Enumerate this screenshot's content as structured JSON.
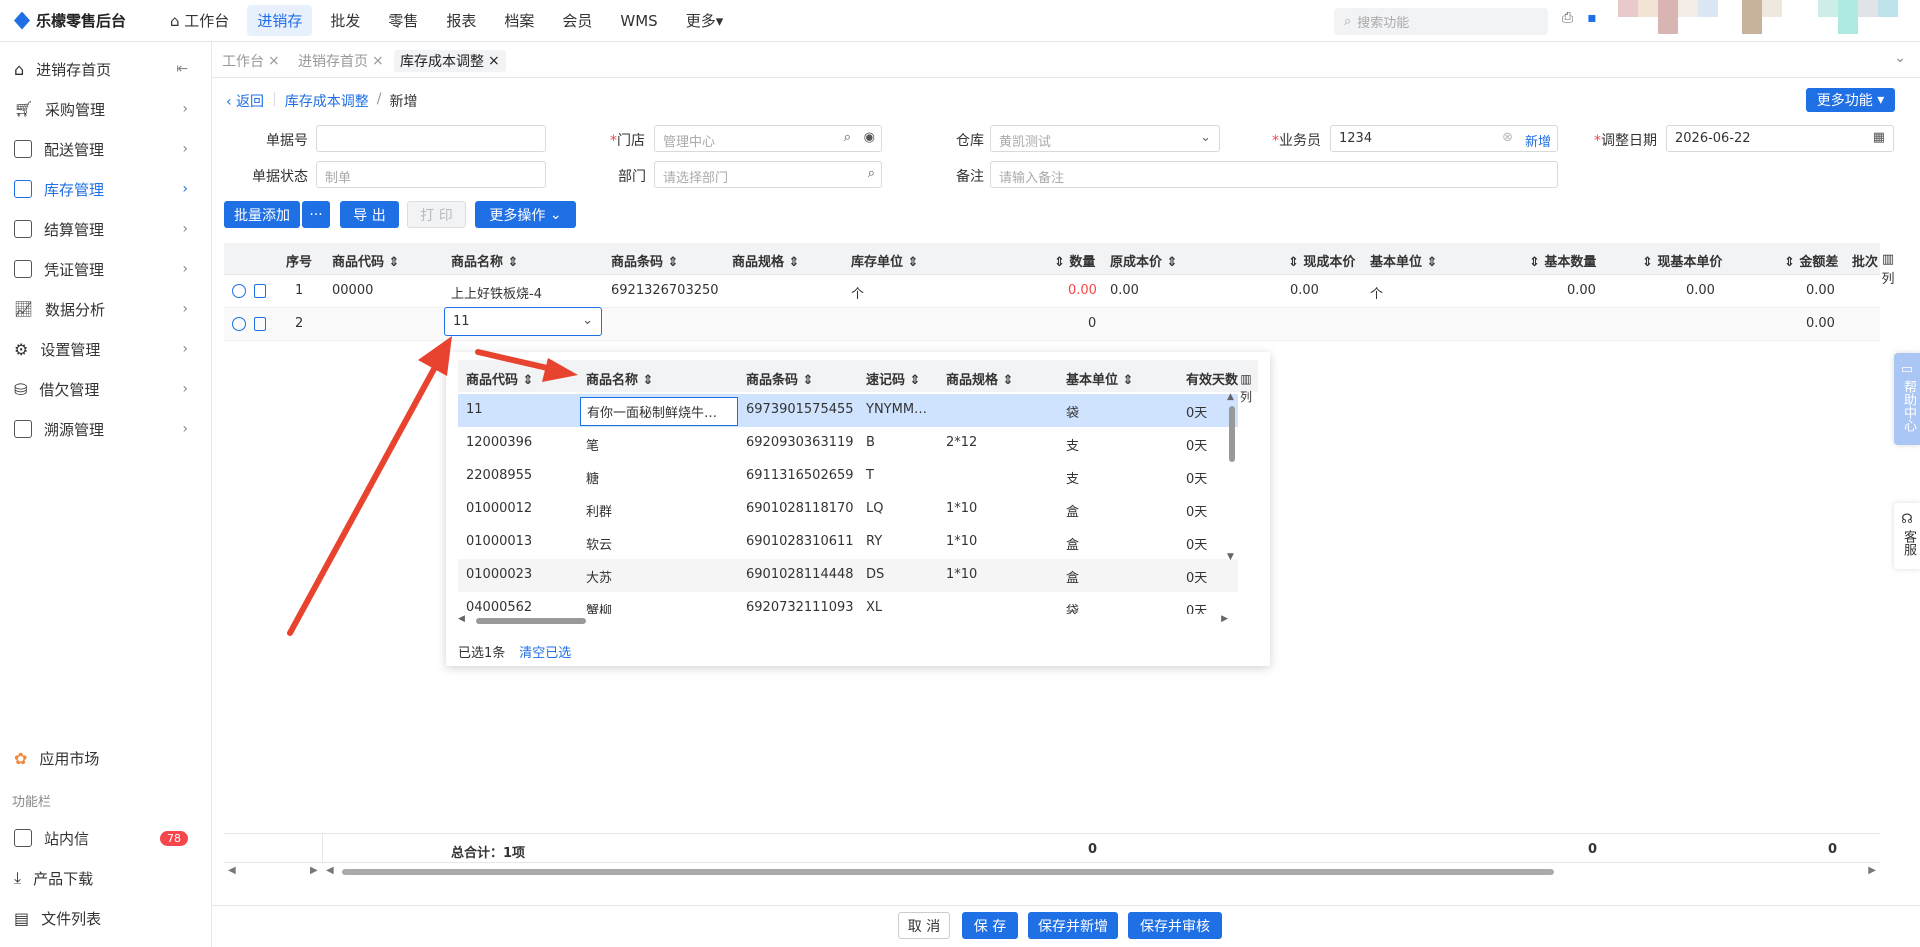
{
  "app": {
    "title": "乐檬零售后台"
  },
  "topnav": [
    "工作台",
    "进销存",
    "批发",
    "零售",
    "报表",
    "档案",
    "会员",
    "WMS",
    "更多"
  ],
  "search": {
    "placeholder": "搜索功能"
  },
  "sidebar": {
    "items": [
      "进销存首页",
      "采购管理",
      "配送管理",
      "库存管理",
      "结算管理",
      "凭证管理",
      "数据分析",
      "设置管理",
      "借欠管理",
      "溯源管理"
    ],
    "app_market": "应用市场",
    "section": "功能栏",
    "inbox": "站内信",
    "inbox_badge": "78",
    "download": "产品下载",
    "files": "文件列表"
  },
  "tabs": [
    "工作台",
    "进销存首页",
    "库存成本调整"
  ],
  "breadcrumb": {
    "back": "返回",
    "parent": "库存成本调整",
    "current": "新增"
  },
  "more_func": "更多功能",
  "form": {
    "doc_no_label": "单据号",
    "doc_no_value": "",
    "store_label": "门店",
    "store_placeholder": "管理中心",
    "warehouse_label": "仓库",
    "warehouse_placeholder": "黄凯测试",
    "salesman_label": "业务员",
    "salesman_value": "1234",
    "salesman_add": "新增",
    "date_label": "调整日期",
    "date_value": "2026-06-22",
    "status_label": "单据状态",
    "status_placeholder": "制单",
    "dept_label": "部门",
    "dept_placeholder": "请选择部门",
    "remark_label": "备注",
    "remark_placeholder": "请输入备注"
  },
  "toolbar": {
    "batch_add": "批量添加",
    "more_dots": "···",
    "export": "导 出",
    "print": "打 印",
    "more_ops": "更多操作"
  },
  "table": {
    "headers": [
      "序号",
      "商品代码",
      "商品名称",
      "商品条码",
      "商品规格",
      "库存单位",
      "数量",
      "原成本价",
      "现成本价",
      "基本单位",
      "基本数量",
      "现基本单价",
      "金额差",
      "批次"
    ],
    "col_setting": "列",
    "rows": [
      {
        "idx": "1",
        "code": "00000",
        "name": "上上好铁板烧-4",
        "barcode": "6921326703250",
        "unit": "个",
        "qty": "0.00",
        "old_cost": "0.00",
        "new_cost": "0.00",
        "base_unit": "个",
        "base_qty": "0.00",
        "base_price": "0.00",
        "diff": "0.00"
      },
      {
        "idx": "2",
        "select_value": "11",
        "qty": "0",
        "diff": "0.00"
      }
    ],
    "total_label": "总合计：1项",
    "total_qty": "0",
    "total_base_qty": "0",
    "total_diff": "0"
  },
  "dropdown": {
    "headers": [
      "商品代码",
      "商品名称",
      "商品条码",
      "速记码",
      "商品规格",
      "基本单位",
      "有效天数"
    ],
    "col_setting": "列",
    "rows": [
      [
        "11",
        "有你一面秘制鲜烧牛…",
        "6973901575455",
        "YNYMM…",
        "",
        "袋",
        "0天"
      ],
      [
        "12000396",
        "笔",
        "6920930363119",
        "B",
        "2*12",
        "支",
        "0天"
      ],
      [
        "22008955",
        "糖",
        "6911316502659",
        "T",
        "",
        "支",
        "0天"
      ],
      [
        "01000012",
        "利群",
        "6901028118170",
        "LQ",
        "1*10",
        "盒",
        "0天"
      ],
      [
        "01000013",
        "软云",
        "6901028310611",
        "RY",
        "1*10",
        "盒",
        "0天"
      ],
      [
        "01000023",
        "大苏",
        "6901028114448",
        "DS",
        "1*10",
        "盒",
        "0天"
      ],
      [
        "04000562",
        "蟹柳",
        "6920732111093",
        "XL",
        "",
        "袋",
        "0天"
      ]
    ],
    "selected_count": "已选1条",
    "clear": "清空已选"
  },
  "bottom": {
    "cancel": "取 消",
    "save": "保 存",
    "save_new": "保存并新增",
    "save_audit": "保存并审核"
  },
  "float": {
    "help": "帮助中心",
    "service": "客服"
  },
  "colors": {
    "primary": "#1f6fe5",
    "arrow": "#e8432f",
    "danger": "#f5474b"
  }
}
